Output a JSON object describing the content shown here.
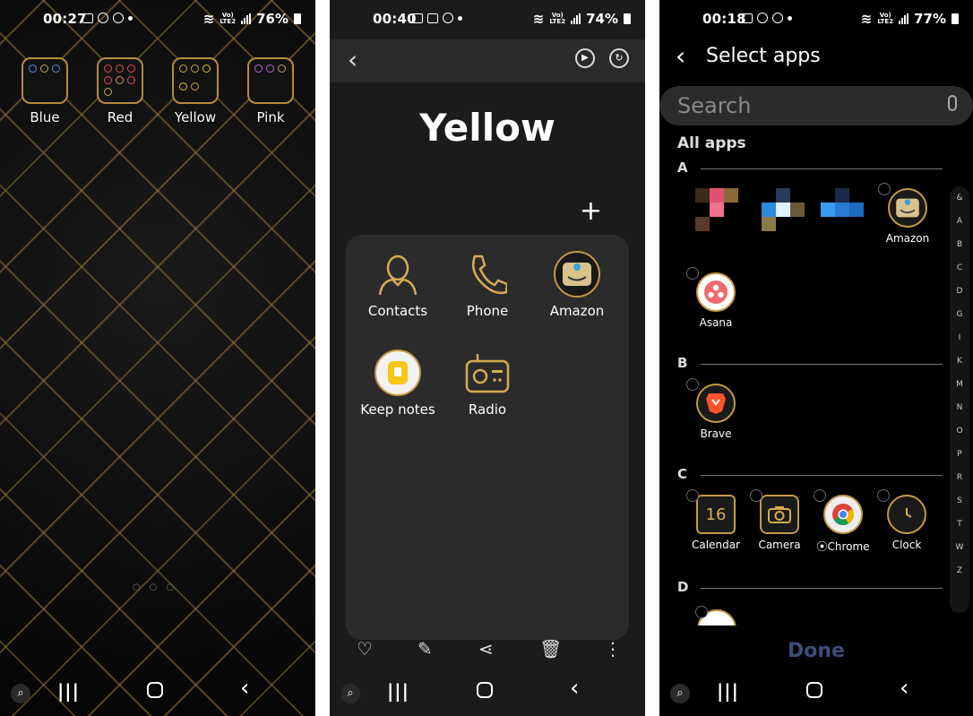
{
  "screen1": {
    "status": {
      "time": "00:27",
      "battery": "76%",
      "net_top": "Vo)",
      "net_bottom": "LTE2"
    },
    "folders": [
      {
        "label": "Blue",
        "dot_color": "#4a90e2"
      },
      {
        "label": "Red",
        "dot_color": "#e05050"
      },
      {
        "label": "Yellow",
        "dot_color": "#e8c040"
      },
      {
        "label": "Pink",
        "dot_color": "#c060e0"
      }
    ]
  },
  "screen2": {
    "status": {
      "time": "00:40",
      "battery": "74%",
      "net_top": "Vo)",
      "net_bottom": "LTE2"
    },
    "folder_title": "Yellow",
    "apps": [
      {
        "label": "Contacts",
        "icon": "contacts-icon"
      },
      {
        "label": "Phone",
        "icon": "phone-icon"
      },
      {
        "label": "Amazon",
        "icon": "amazon-icon"
      },
      {
        "label": "Keep notes",
        "icon": "keep-notes-icon"
      },
      {
        "label": "Radio",
        "icon": "radio-icon"
      }
    ],
    "add_glyph": "+"
  },
  "screen3": {
    "status": {
      "time": "00:18",
      "battery": "77%",
      "net_top": "Vo)",
      "net_bottom": "LTE2"
    },
    "title": "Select apps",
    "search_placeholder": "Search",
    "all_apps_label": "All apps",
    "sections": [
      {
        "letter": "A",
        "apps": [
          "Amazon",
          "Asana"
        ]
      },
      {
        "letter": "B",
        "apps": [
          "Brave"
        ]
      },
      {
        "letter": "C",
        "apps": [
          "Calendar",
          "Camera",
          "Chrome",
          "Clock"
        ]
      },
      {
        "letter": "D",
        "apps": []
      }
    ],
    "calendar_day": "16",
    "index_letters": [
      "&",
      "A",
      "B",
      "C",
      "D",
      "G",
      "I",
      "K",
      "M",
      "N",
      "O",
      "P",
      "R",
      "S",
      "T",
      "W",
      "Z"
    ],
    "done_label": "Done"
  }
}
